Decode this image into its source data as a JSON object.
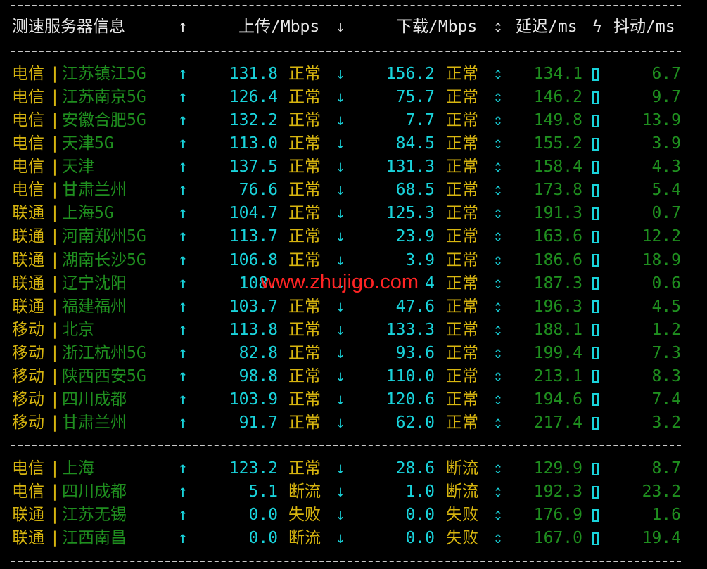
{
  "header": {
    "col_location": "测速服务器信息",
    "arrow_up": "↑",
    "col_upload": "上传/Mbps",
    "arrow_down": "↓",
    "col_download": "下载/Mbps",
    "arrow_updown": "⇕",
    "col_latency": "延迟/ms",
    "bolt": "ϟ",
    "col_jitter": "抖动/ms"
  },
  "group1": [
    {
      "isp": "电信",
      "sep": "|",
      "city": "江苏镇江5G",
      "up": "131.8",
      "up_status": "正常",
      "down": "156.2",
      "down_status": "正常",
      "latency": "134.1",
      "jitter": "6.7"
    },
    {
      "isp": "电信",
      "sep": "|",
      "city": "江苏南京5G",
      "up": "126.4",
      "up_status": "正常",
      "down": "75.7",
      "down_status": "正常",
      "latency": "146.2",
      "jitter": "9.7"
    },
    {
      "isp": "电信",
      "sep": "|",
      "city": "安徽合肥5G",
      "up": "132.2",
      "up_status": "正常",
      "down": "7.7",
      "down_status": "正常",
      "latency": "149.8",
      "jitter": "13.9"
    },
    {
      "isp": "电信",
      "sep": "|",
      "city": "天津5G",
      "up": "113.0",
      "up_status": "正常",
      "down": "84.5",
      "down_status": "正常",
      "latency": "155.2",
      "jitter": "3.9"
    },
    {
      "isp": "电信",
      "sep": "|",
      "city": "天津",
      "up": "137.5",
      "up_status": "正常",
      "down": "131.3",
      "down_status": "正常",
      "latency": "158.4",
      "jitter": "4.3"
    },
    {
      "isp": "电信",
      "sep": "|",
      "city": "甘肃兰州",
      "up": "76.6",
      "up_status": "正常",
      "down": "68.5",
      "down_status": "正常",
      "latency": "173.8",
      "jitter": "5.4"
    },
    {
      "isp": "联通",
      "sep": "|",
      "city": "上海5G",
      "up": "104.7",
      "up_status": "正常",
      "down": "125.3",
      "down_status": "正常",
      "latency": "191.3",
      "jitter": "0.7"
    },
    {
      "isp": "联通",
      "sep": "|",
      "city": "河南郑州5G",
      "up": "113.7",
      "up_status": "正常",
      "down": "23.9",
      "down_status": "正常",
      "latency": "163.6",
      "jitter": "12.2"
    },
    {
      "isp": "联通",
      "sep": "|",
      "city": "湖南长沙5G",
      "up": "106.8",
      "up_status": "正常",
      "down": "3.9",
      "down_status": "正常",
      "latency": "186.6",
      "jitter": "18.9"
    },
    {
      "isp": "联通",
      "sep": "|",
      "city": "辽宁沈阳",
      "up": "108.",
      "up_status": "",
      "down": "4",
      "down_status": "正常",
      "latency": "187.3",
      "jitter": "0.6"
    },
    {
      "isp": "联通",
      "sep": "|",
      "city": "福建福州",
      "up": "103.7",
      "up_status": "正常",
      "down": "47.6",
      "down_status": "正常",
      "latency": "196.3",
      "jitter": "4.5"
    },
    {
      "isp": "移动",
      "sep": "|",
      "city": "北京",
      "up": "113.8",
      "up_status": "正常",
      "down": "133.3",
      "down_status": "正常",
      "latency": "188.1",
      "jitter": "1.2"
    },
    {
      "isp": "移动",
      "sep": "|",
      "city": "浙江杭州5G",
      "up": "82.8",
      "up_status": "正常",
      "down": "93.6",
      "down_status": "正常",
      "latency": "199.4",
      "jitter": "7.3"
    },
    {
      "isp": "移动",
      "sep": "|",
      "city": "陕西西安5G",
      "up": "98.8",
      "up_status": "正常",
      "down": "110.0",
      "down_status": "正常",
      "latency": "213.1",
      "jitter": "8.3"
    },
    {
      "isp": "移动",
      "sep": "|",
      "city": "四川成都",
      "up": "103.9",
      "up_status": "正常",
      "down": "120.6",
      "down_status": "正常",
      "latency": "194.6",
      "jitter": "7.4"
    },
    {
      "isp": "移动",
      "sep": "|",
      "city": "甘肃兰州",
      "up": "91.7",
      "up_status": "正常",
      "down": "62.0",
      "down_status": "正常",
      "latency": "217.4",
      "jitter": "3.2"
    }
  ],
  "group2": [
    {
      "isp": "电信",
      "sep": "|",
      "city": "上海",
      "up": "123.2",
      "up_status": "正常",
      "down": "28.6",
      "down_status": "断流",
      "latency": "129.9",
      "jitter": "8.7"
    },
    {
      "isp": "电信",
      "sep": "|",
      "city": "四川成都",
      "up": "5.1",
      "up_status": "断流",
      "down": "1.0",
      "down_status": "断流",
      "latency": "192.3",
      "jitter": "23.2"
    },
    {
      "isp": "联通",
      "sep": "|",
      "city": "江苏无锡",
      "up": "0.0",
      "up_status": "失败",
      "down": "0.0",
      "down_status": "失败",
      "latency": "176.9",
      "jitter": "1.6"
    },
    {
      "isp": "联通",
      "sep": "|",
      "city": "江西南昌",
      "up": "0.0",
      "up_status": "断流",
      "down": "0.0",
      "down_status": "失败",
      "latency": "167.0",
      "jitter": "19.4"
    }
  ],
  "watermark": "www.zhujigo.com",
  "colors": {
    "background": "#000000",
    "isp": "#d7b50f",
    "city": "#1f8f1f",
    "value": "#19d3db",
    "watermark": "#ff2424"
  }
}
